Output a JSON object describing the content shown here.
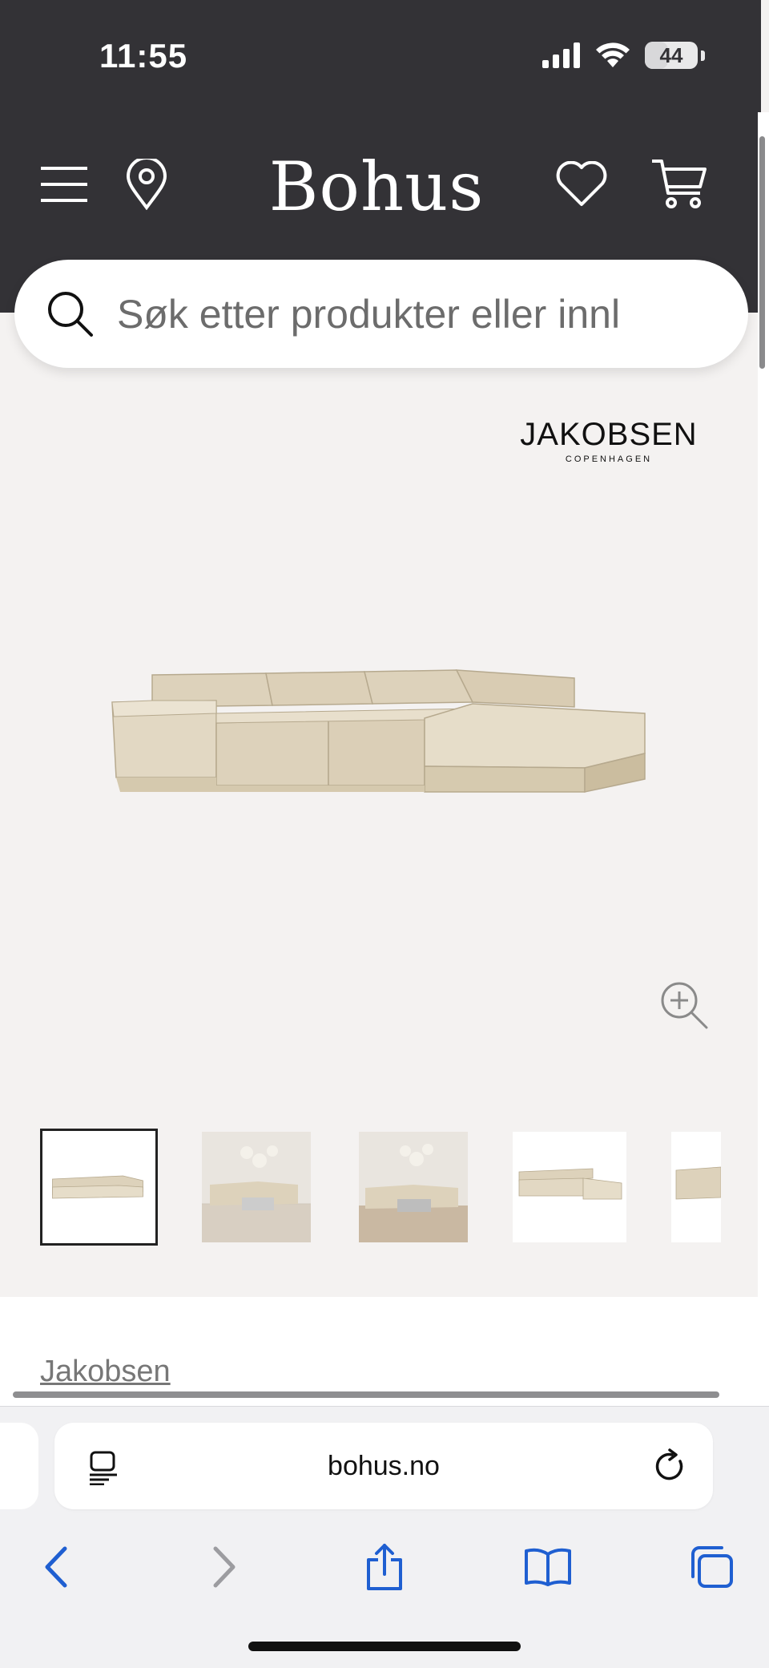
{
  "status_bar": {
    "time": "11:55",
    "battery": "44",
    "battery_level": 0.44
  },
  "header": {
    "logo": "Bohus",
    "menu_icon": "hamburger-menu-icon",
    "location_icon": "map-pin-icon",
    "wishlist_icon": "heart-icon",
    "cart_icon": "cart-icon",
    "background_color": "#333236"
  },
  "search": {
    "placeholder": "Søk etter produkter eller innl",
    "icon": "search-icon"
  },
  "product": {
    "brand_logo": {
      "name": "JAKOBSEN",
      "sub": "COPENHAGEN"
    },
    "zoom_icon": "zoom-in-icon",
    "thumbnails": [
      {
        "kind": "sofa-white-background",
        "active": true
      },
      {
        "kind": "sofa-room-scene",
        "active": false
      },
      {
        "kind": "sofa-room-scene",
        "active": false
      },
      {
        "kind": "sofa-white-background",
        "active": false
      },
      {
        "kind": "sofa-white-background-partial",
        "active": false
      }
    ],
    "brand_link": "Jakobsen"
  },
  "safari": {
    "url": "bohus.no",
    "reader_icon": "page-menu-icon",
    "reload_icon": "reload-icon",
    "toolbar": [
      "back-icon",
      "forward-icon",
      "share-icon",
      "bookmarks-icon",
      "tabs-icon"
    ],
    "accent_color": "#1f5fd1"
  }
}
